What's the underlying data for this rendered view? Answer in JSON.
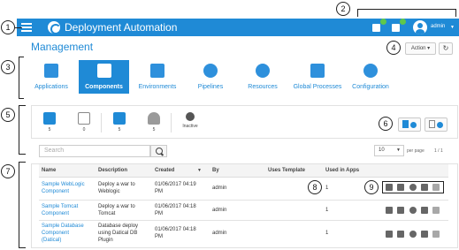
{
  "topbar": {
    "title": "Deployment Automation",
    "user": "admin"
  },
  "page": {
    "title": "Management",
    "action_label": "Action"
  },
  "nav": [
    {
      "label": "Applications"
    },
    {
      "label": "Components"
    },
    {
      "label": "Environments"
    },
    {
      "label": "Pipelines"
    },
    {
      "label": "Resources"
    },
    {
      "label": "Global Processes"
    },
    {
      "label": "Configuration"
    }
  ],
  "filters": [
    {
      "count": "5",
      "icon": "component-icon"
    },
    {
      "count": "0",
      "icon": "component-outline-icon"
    },
    {
      "count": "5",
      "icon": "user-icon"
    },
    {
      "count": "5",
      "icon": "group-icon"
    },
    {
      "count": "Inactive",
      "icon": "inactive-icon"
    }
  ],
  "search": {
    "placeholder": "Search"
  },
  "pagination": {
    "per_page": "10",
    "per_page_label": "per page",
    "pages": "1 / 1"
  },
  "table": {
    "headers": [
      "Name",
      "Description",
      "Created",
      "By",
      "Uses Template",
      "Used in Apps"
    ],
    "rows": [
      {
        "name1": "Sample WebLogic",
        "name2": "Component",
        "desc1": "Deploy a war to",
        "desc2": "Weblogic",
        "desc3": "",
        "created1": "01/06/2017 04:19",
        "created2": "PM",
        "by": "admin",
        "apps": "1"
      },
      {
        "name1": "Sample Tomcat",
        "name2": "Component",
        "desc1": "Deploy a war to",
        "desc2": "Tomcat",
        "desc3": "",
        "created1": "01/06/2017 04:18",
        "created2": "PM",
        "by": "admin",
        "apps": "1"
      },
      {
        "name1": "Sample Database",
        "name2": "Component",
        "name3": "(Datical)",
        "desc1": "Database deploy",
        "desc2": "using Datical DB",
        "desc3": "Plugin",
        "created1": "01/06/2017 04:18",
        "created2": "PM",
        "by": "admin",
        "apps": "1"
      }
    ]
  },
  "callouts": [
    "1",
    "2",
    "3",
    "4",
    "5",
    "6",
    "7",
    "8",
    "9"
  ],
  "colors": {
    "brand": "#1f8ad6",
    "badge": "#5fc84b"
  }
}
